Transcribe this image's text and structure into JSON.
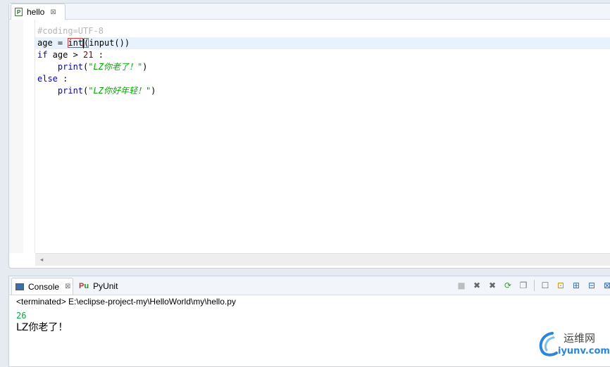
{
  "editor": {
    "tab": {
      "label": "hello",
      "close_glyph": "⊠",
      "icon": "python-file-icon"
    },
    "code": {
      "line1": {
        "comment": "#coding=UTF-8"
      },
      "line2": {
        "a": "age = ",
        "int": "int",
        "paren": "(",
        "rest": "input())"
      },
      "line3": {
        "kw": "if",
        "a": " age > ",
        "num": "21",
        "b": " :"
      },
      "line4": {
        "indent": "    ",
        "fn": "print",
        "open": "(",
        "str": "\"LZ你老了！\"",
        "close": ")"
      },
      "line5": {
        "kw": "else",
        "b": " :"
      },
      "line6": {
        "indent": "    ",
        "fn": "print",
        "open": "(",
        "str": "\"LZ你好年轻！\"",
        "close": ")"
      }
    },
    "scroll_left_glyph": "◂"
  },
  "console": {
    "tabs": {
      "console": {
        "label": "Console",
        "close_glyph": "⊠"
      },
      "pyunit": {
        "label": "PyUnit"
      }
    },
    "toolbar_icons": [
      "terminate-icon",
      "remove-launch-icon",
      "remove-all-icon",
      "relaunch-icon",
      "copy-icon",
      "clear-console-icon",
      "scroll-lock-icon",
      "pin-console-icon",
      "open-console-icon",
      "display-selected-console-icon"
    ],
    "toolbar_glyphs": {
      "terminate": "■",
      "remove": "✖",
      "remove_all": "✖",
      "relaunch": "⟳",
      "pages": "❐",
      "clear": "☐",
      "lock": "⊡",
      "pin": "⊞",
      "open": "⊟",
      "display": "⊠"
    },
    "status": "<terminated> E:\\eclipse-project-my\\HelloWorld\\my\\hello.py",
    "output": {
      "input_value": "26",
      "result": "LZ你老了！"
    }
  },
  "watermark": {
    "cn": "运维网",
    "url": "iyunv.com"
  },
  "colors": {
    "keyword": "#0000c0",
    "string": "#00aa00",
    "number": "#800000",
    "comment": "#b7b7b7",
    "stdin": "#00aa44"
  }
}
